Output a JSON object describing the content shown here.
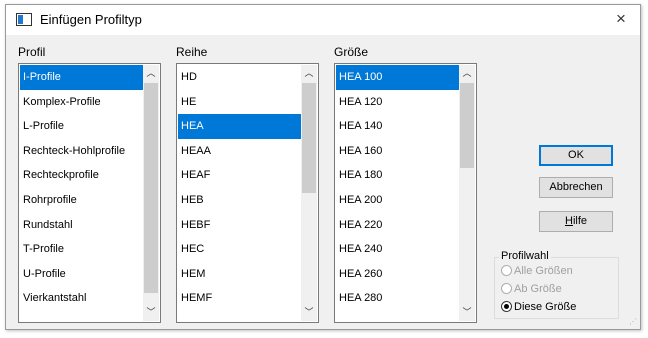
{
  "window": {
    "title": "Einfügen Profiltyp",
    "close_glyph": "×"
  },
  "columns": {
    "profil": {
      "label": "Profil",
      "items": [
        "I-Profile",
        "Komplex-Profile",
        "L-Profile",
        "Rechteck-Hohlprofile",
        "Rechteckprofile",
        "Rohrprofile",
        "Rundstahl",
        "T-Profile",
        "U-Profile",
        "Vierkantstahl"
      ],
      "selected_index": 0
    },
    "reihe": {
      "label": "Reihe",
      "items": [
        "HD",
        "HE",
        "HEA",
        "HEAA",
        "HEAF",
        "HEB",
        "HEBF",
        "HEC",
        "HEM",
        "HEMF"
      ],
      "selected_index": 2
    },
    "groesse": {
      "label": "Größe",
      "items": [
        "HEA 100",
        "HEA 120",
        "HEA 140",
        "HEA 160",
        "HEA 180",
        "HEA 200",
        "HEA 220",
        "HEA 240",
        "HEA 260",
        "HEA 280"
      ],
      "selected_index": 0
    }
  },
  "buttons": {
    "ok": "OK",
    "cancel": "Abbrechen",
    "help": "Hilfe"
  },
  "profilwahl": {
    "title": "Profilwahl",
    "options": [
      {
        "label": "Alle Größen",
        "enabled": false,
        "checked": false
      },
      {
        "label": "Ab Größe",
        "enabled": false,
        "checked": false
      },
      {
        "label": "Diese Größe",
        "enabled": true,
        "checked": true
      }
    ]
  },
  "colors": {
    "selection": "#0078d7",
    "dialog_bg": "#f0f0f0"
  }
}
